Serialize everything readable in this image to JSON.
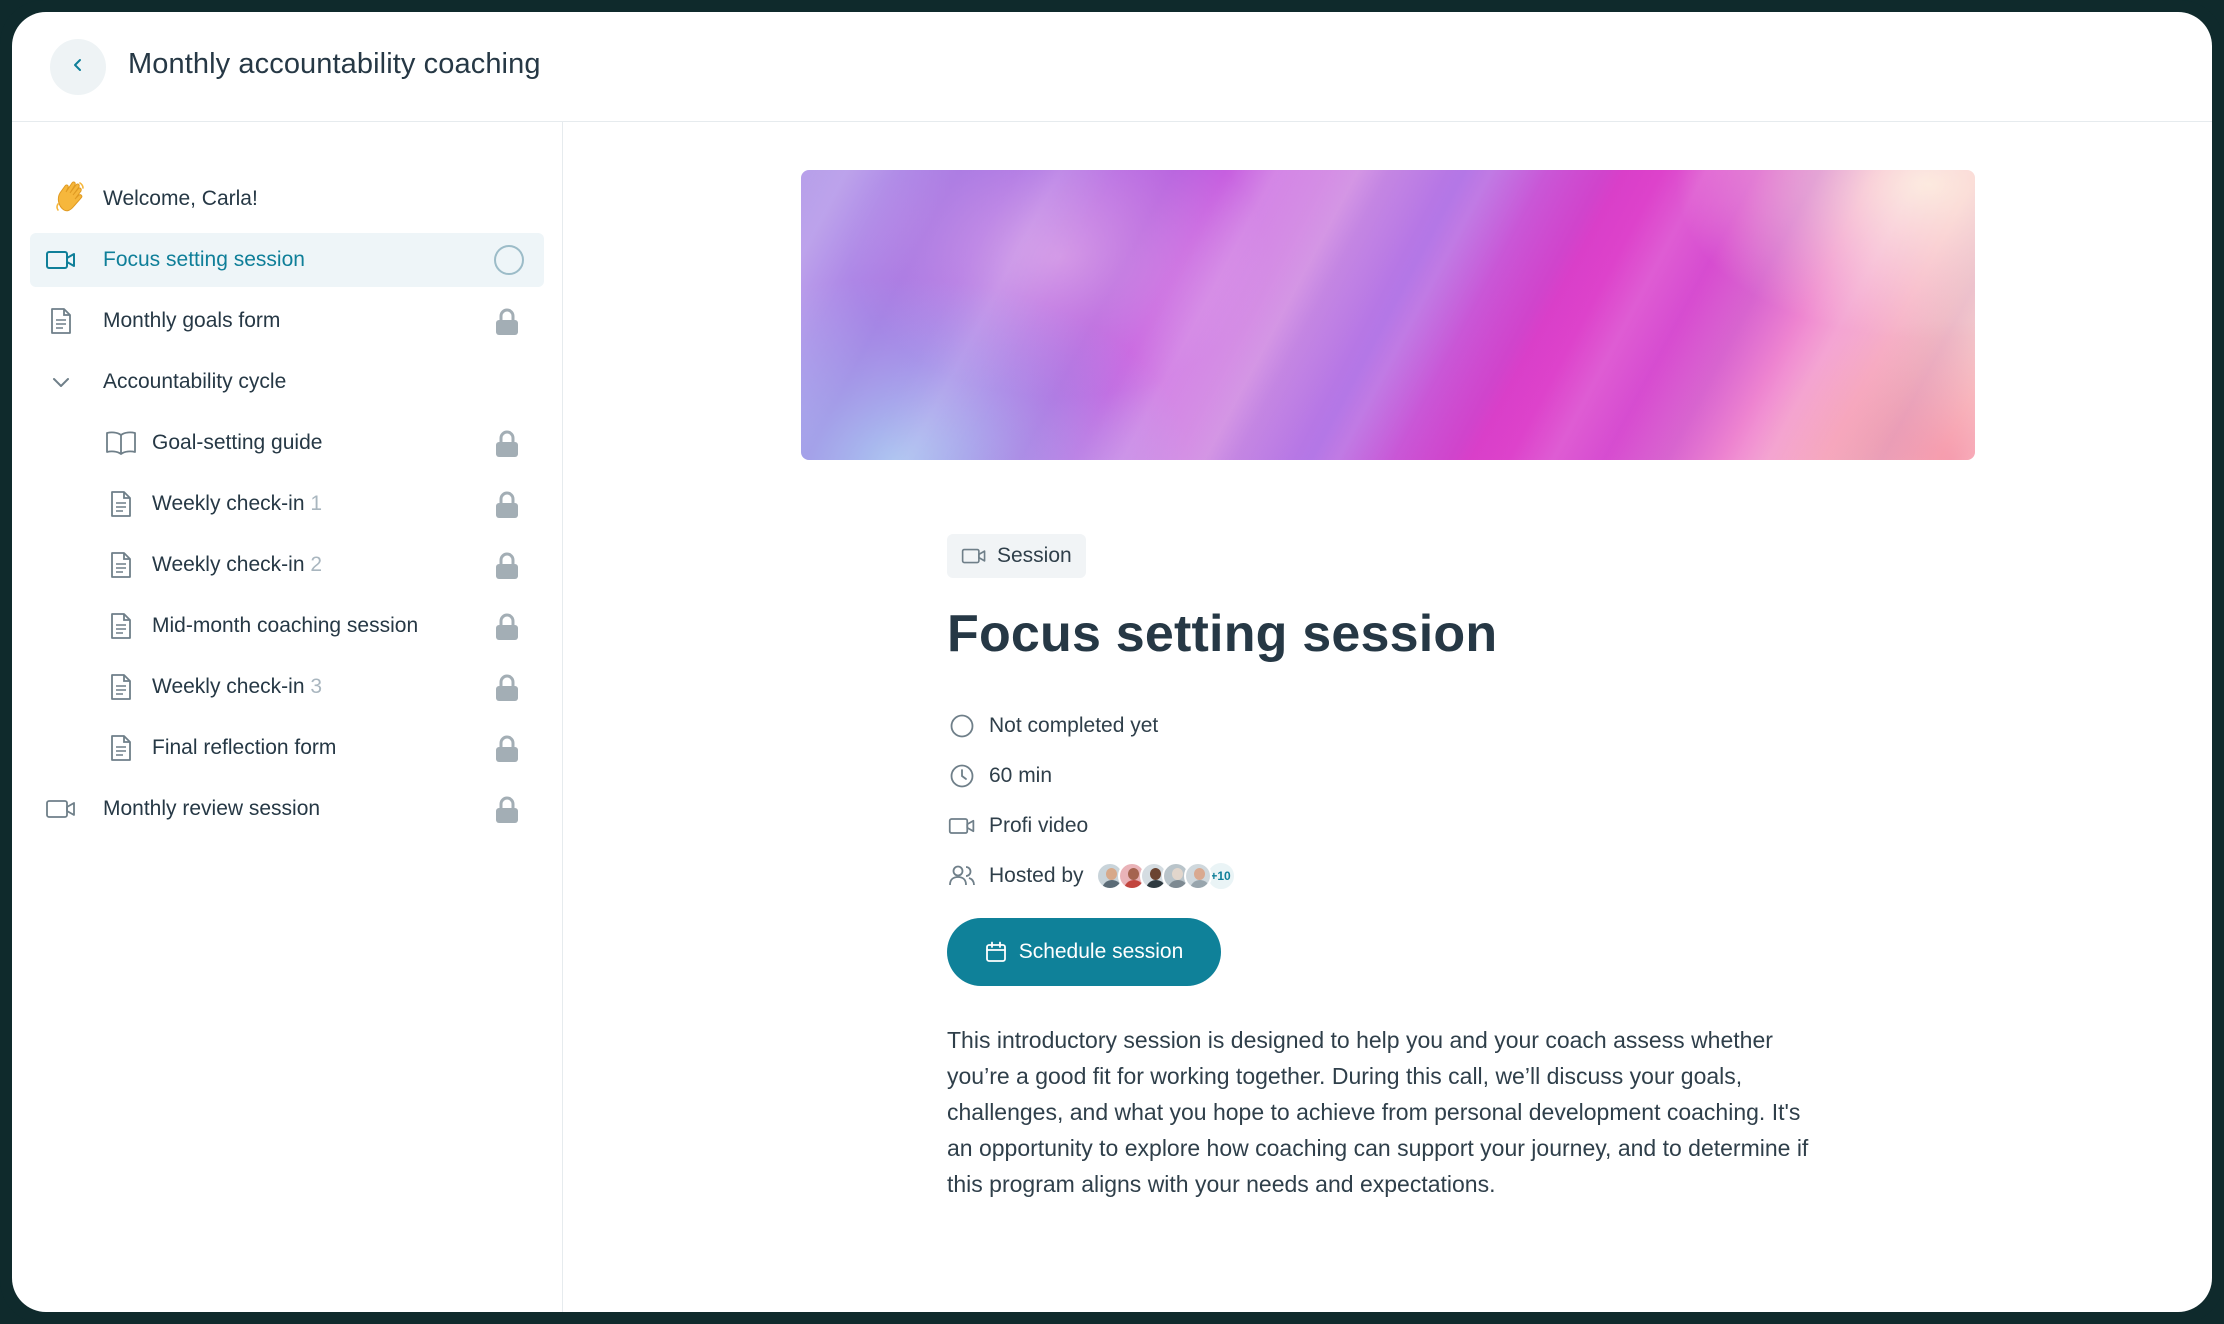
{
  "header": {
    "title": "Monthly accountability coaching",
    "back_icon": "chevron-left-icon"
  },
  "sidebar": {
    "items": [
      {
        "label": "Welcome, Carla!",
        "icon": "waving-hand-icon",
        "status": "none"
      },
      {
        "label": "Focus setting session",
        "icon": "video-camera-icon",
        "status": "not-completed",
        "active": true
      },
      {
        "label": "Monthly goals form",
        "icon": "document-icon",
        "status": "locked"
      },
      {
        "label": "Accountability cycle",
        "icon": "chevron-down-icon",
        "status": "expanded"
      },
      {
        "label": "Goal-setting guide",
        "icon": "book-icon",
        "status": "locked"
      },
      {
        "label": "Weekly check-in",
        "number": "1",
        "icon": "document-icon",
        "status": "locked"
      },
      {
        "label": "Weekly check-in",
        "number": "2",
        "icon": "document-icon",
        "status": "locked"
      },
      {
        "label": "Mid-month coaching session",
        "icon": "document-icon",
        "status": "locked"
      },
      {
        "label": "Weekly check-in",
        "number": "3",
        "icon": "document-icon",
        "status": "locked"
      },
      {
        "label": "Final reflection form",
        "icon": "document-icon",
        "status": "locked"
      },
      {
        "label": "Monthly review session",
        "icon": "video-camera-icon",
        "status": "locked"
      }
    ]
  },
  "main": {
    "badge": "Session",
    "title": "Focus setting session",
    "meta": {
      "status": "Not completed yet",
      "duration": "60 min",
      "platform": "Profi video",
      "hosted_by": "Hosted by",
      "hosts_more": "+10"
    },
    "schedule_button": "Schedule session",
    "description": "This introductory session is designed to help you and your coach assess whether you’re a good fit for working together. During this call, we’ll discuss your goals, challenges, and what you hope to achieve from personal development coaching. It's an opportunity to explore how coaching can support your journey, and to determine if this program aligns with your needs and expectations."
  },
  "colors": {
    "accent": "#0f8199",
    "active_bg": "#eef5f8",
    "text": "#263845",
    "muted": "#a9b6bf",
    "frame": "#0f2a2c"
  }
}
